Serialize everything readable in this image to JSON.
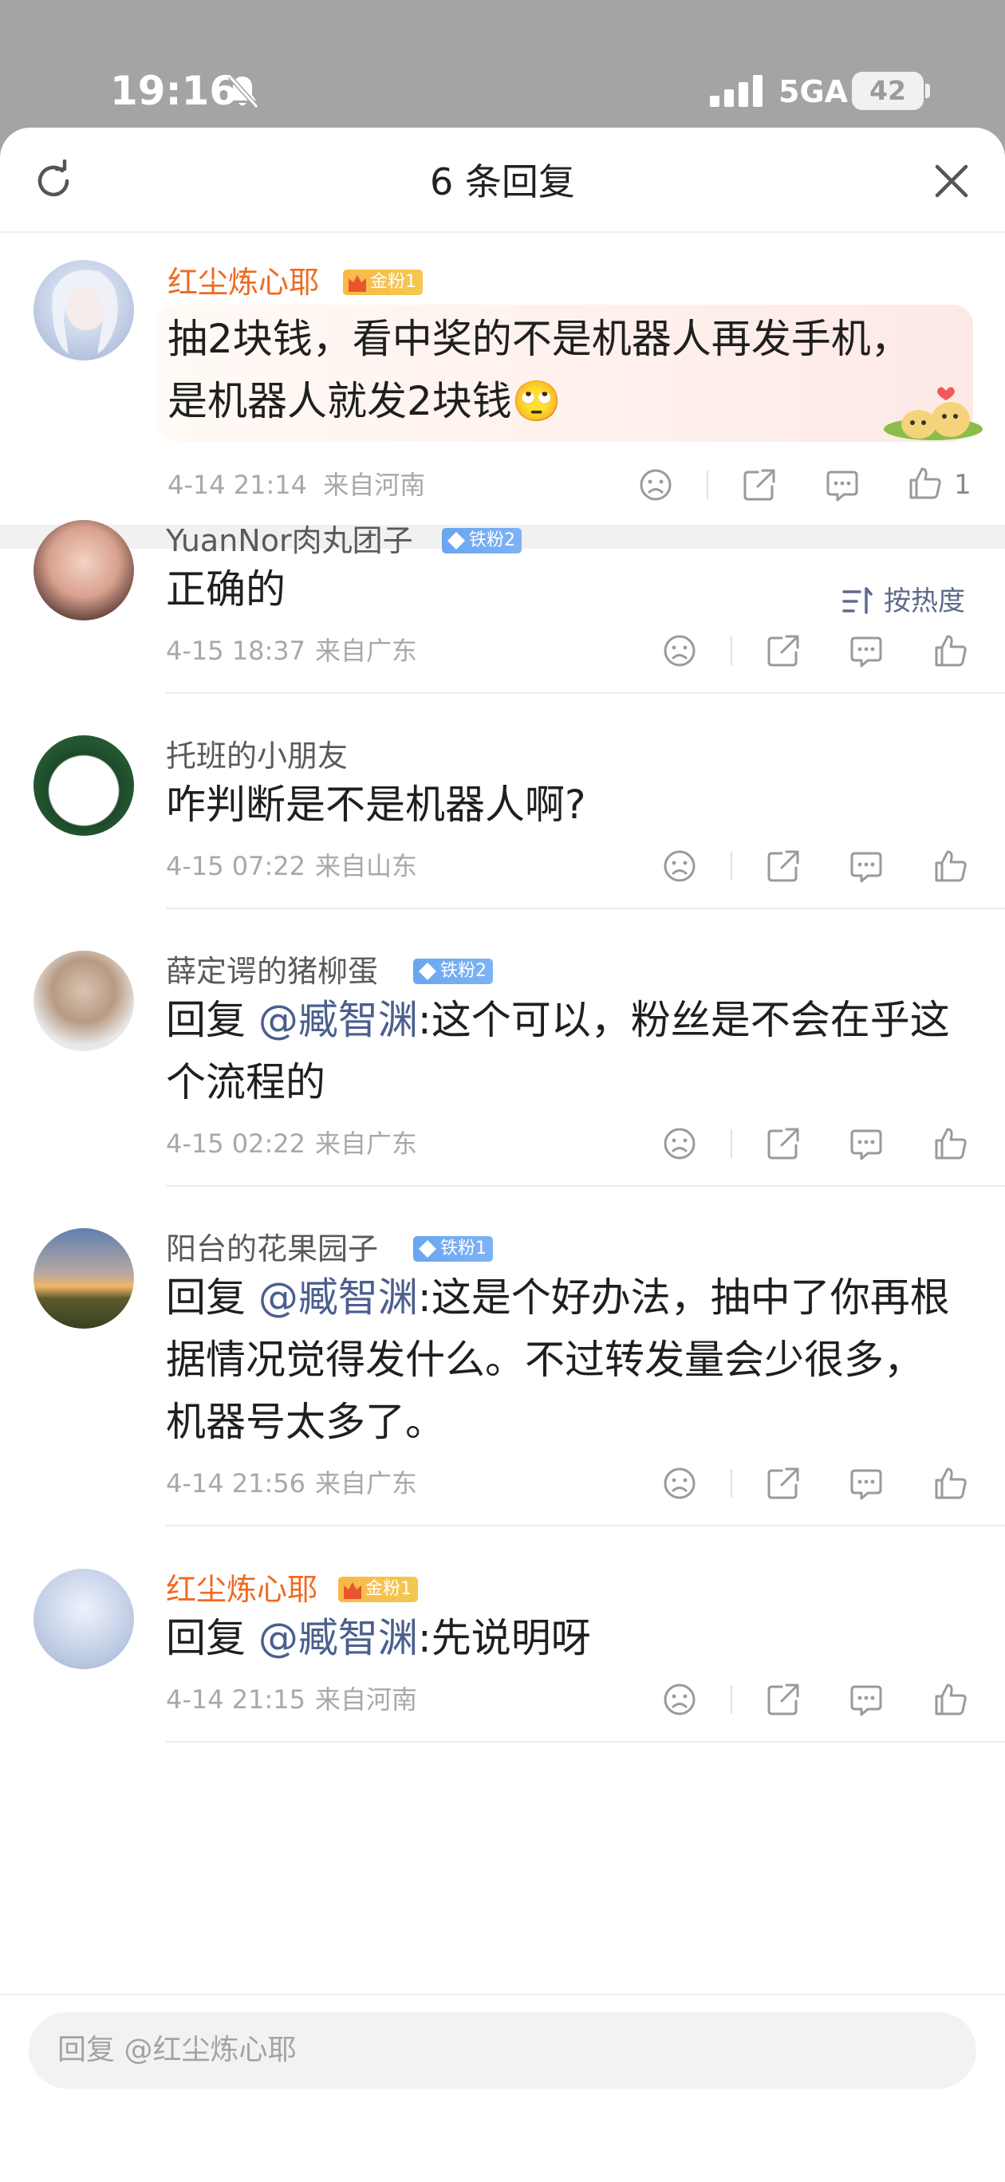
{
  "status_bar": {
    "time": "19:16",
    "network": "5GA",
    "battery": "42"
  },
  "header": {
    "title": "6 条回复"
  },
  "main_comment": {
    "username": "红尘炼心耶",
    "badge": "金粉1",
    "text": "抽2块钱，看中奖的不是机器人再发手机，是机器人就发2块钱🙄",
    "time": "4-14 21:14",
    "location": "来自河南",
    "like_count": "1"
  },
  "sort_label": "按热度",
  "replies": [
    {
      "username": "YuanNor肉丸团子",
      "badge": "铁粉2",
      "prefix": "",
      "mention": "",
      "text": "正确的",
      "time": "4-15 18:37",
      "location": "来自广东"
    },
    {
      "username": "托班的小朋友",
      "badge": "",
      "prefix": "",
      "mention": "",
      "text": "咋判断是不是机器人啊?",
      "time": "4-15 07:22",
      "location": "来自山东"
    },
    {
      "username": "薛定谔的猪柳蛋",
      "badge": "铁粉2",
      "prefix": "回复",
      "mention": "@臧智渊",
      "text": ":这个可以，粉丝是不会在乎这个流程的",
      "time": "4-15 02:22",
      "location": "来自广东"
    },
    {
      "username": "阳台的花果园子",
      "badge": "铁粉1",
      "prefix": "回复",
      "mention": "@臧智渊",
      "text": ":这是个好办法，抽中了你再根据情况觉得发什么。不过转发量会少很多，机器号太多了。",
      "time": "4-14 21:56",
      "location": "来自广东"
    },
    {
      "username": "红尘炼心耶",
      "badge": "金粉1",
      "prefix": "回复",
      "mention": "@臧智渊",
      "text": ":先说明呀",
      "time": "4-14 21:15",
      "location": "来自河南"
    }
  ],
  "reply_input": {
    "placeholder": "回复 @红尘炼心耶"
  },
  "colors": {
    "accent_orange": "#ef6a20",
    "mention_blue": "#4b5f8e",
    "meta_gray": "#a8a8a8"
  }
}
